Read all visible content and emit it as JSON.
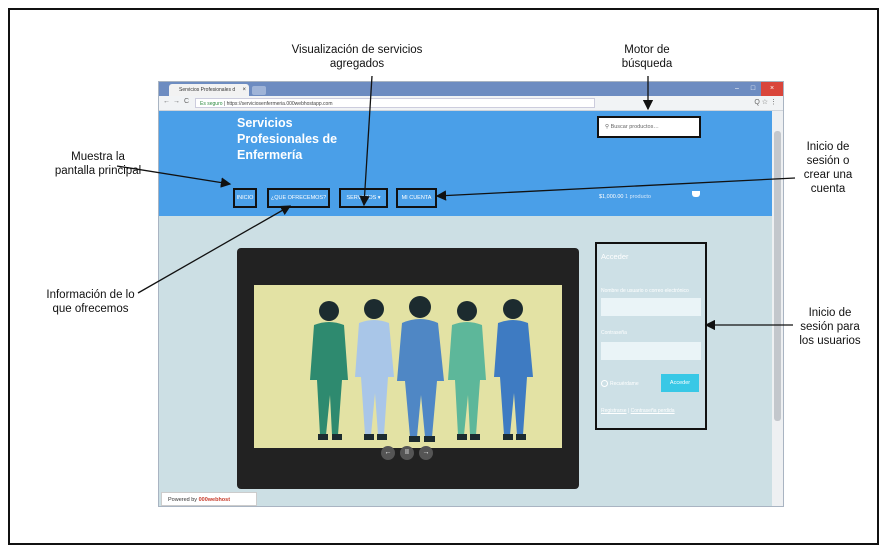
{
  "annotations": {
    "visualizacion": "Visualización de servicios agregados",
    "motor": "Motor de búsqueda",
    "principal": "Muestra la pantalla principal",
    "inicio_sesion": "Inicio de sesión o crear una cuenta",
    "informacion": "Información de lo que ofrecemos",
    "usuarios": "Inicio de sesión para los usuarios"
  },
  "browser": {
    "tab_title": "Servicios Profesionales d",
    "tab_close": "×",
    "secure": "Es seguro",
    "url": "https://serviciosenfermeria.000webhostapp.com",
    "back": "←",
    "forward": "→",
    "reload": "C",
    "tools": "Q ☆ ⋮",
    "minimize": "–",
    "maximize": "□",
    "close": "×"
  },
  "site": {
    "title": "Servicios Profesionales de Enfermería",
    "search_placeholder": "Buscar productos…",
    "search_icon": "search-icon",
    "menu": {
      "inicio": "INICIO",
      "ofrecemos": "¿QUE OFRECEMOS?",
      "servicios": "SERVICIOS ▾",
      "cuenta": "MI CUENTA"
    },
    "cart_total": "$1,000.00",
    "cart_items": "1 producto",
    "cart_icon": "basket-icon"
  },
  "slider": {
    "prev": "←",
    "pause": "II",
    "next": "→"
  },
  "login": {
    "title": "Acceder",
    "username_label": "Nombre de usuario o correo electrónico",
    "password_label": "Contraseña",
    "remember": "Recuérdame",
    "button": "Acceder",
    "register": "Registrarse",
    "lost_password": "Contraseña perdida"
  },
  "footer": {
    "powered_by": "Powered by",
    "host": "000webhost"
  }
}
